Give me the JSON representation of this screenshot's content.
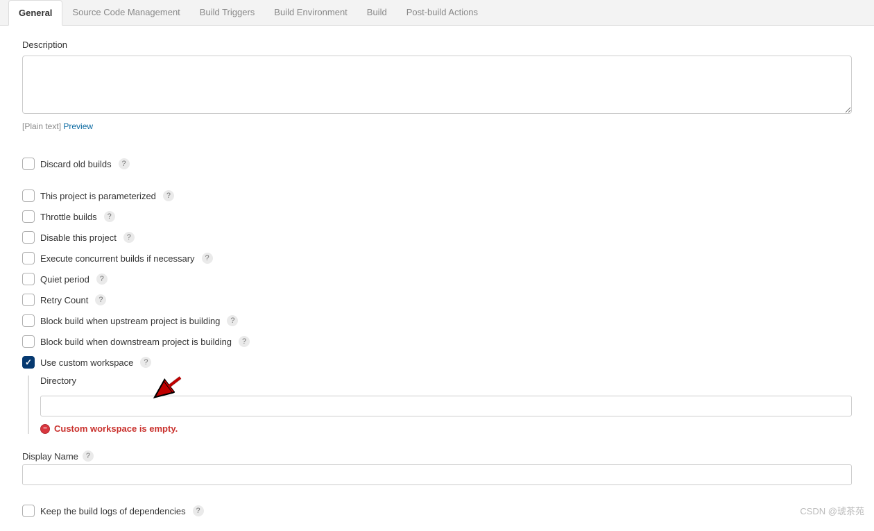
{
  "tabs": [
    {
      "label": "General",
      "active": true
    },
    {
      "label": "Source Code Management",
      "active": false
    },
    {
      "label": "Build Triggers",
      "active": false
    },
    {
      "label": "Build Environment",
      "active": false
    },
    {
      "label": "Build",
      "active": false
    },
    {
      "label": "Post-build Actions",
      "active": false
    }
  ],
  "description": {
    "label": "Description",
    "value": "",
    "plain_text_label": "[Plain text]",
    "preview_label": "Preview"
  },
  "options": [
    {
      "label": "Discard old builds",
      "checked": false,
      "help": true
    },
    {
      "label": "This project is parameterized",
      "checked": false,
      "help": true
    },
    {
      "label": "Throttle builds",
      "checked": false,
      "help": true
    },
    {
      "label": "Disable this project",
      "checked": false,
      "help": true
    },
    {
      "label": "Execute concurrent builds if necessary",
      "checked": false,
      "help": true
    },
    {
      "label": "Quiet period",
      "checked": false,
      "help": true
    },
    {
      "label": "Retry Count",
      "checked": false,
      "help": true
    },
    {
      "label": "Block build when upstream project is building",
      "checked": false,
      "help": true
    },
    {
      "label": "Block build when downstream project is building",
      "checked": false,
      "help": true
    },
    {
      "label": "Use custom workspace",
      "checked": true,
      "help": true
    }
  ],
  "custom_workspace": {
    "directory_label": "Directory",
    "directory_value": "",
    "error_text": "Custom workspace is empty."
  },
  "display_name": {
    "label": "Display Name",
    "value": ""
  },
  "keep_logs": {
    "label": "Keep the build logs of dependencies",
    "checked": false,
    "help": true
  },
  "watermark": "CSDN @琥茶苑"
}
